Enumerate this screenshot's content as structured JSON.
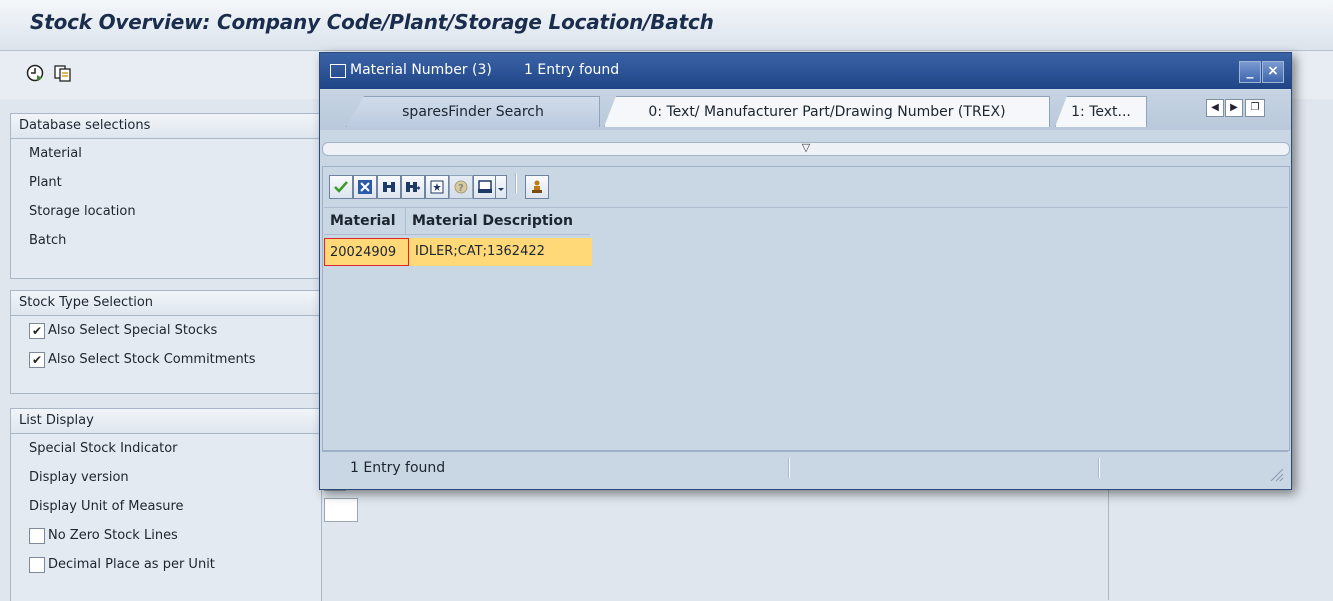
{
  "window": {
    "title": "Stock Overview: Company Code/Plant/Storage Location/Batch"
  },
  "toolbar": {
    "execute_icon": "clock-execute-icon",
    "copy_icon": "copy-selection-icon"
  },
  "groups": {
    "database": {
      "title": "Database selections",
      "fields": [
        "Material",
        "Plant",
        "Storage location",
        "Batch"
      ]
    },
    "stock_type": {
      "title": "Stock Type Selection",
      "checkboxes": [
        {
          "label": "Also Select Special Stocks",
          "checked": "✔"
        },
        {
          "label": "Also Select Stock Commitments",
          "checked": "✔"
        }
      ]
    },
    "list_display": {
      "title": "List Display",
      "fields": [
        "Special Stock Indicator",
        "Display version",
        "Display Unit of Measure"
      ],
      "checkboxes": [
        {
          "label": "No Zero Stock Lines",
          "checked": ""
        },
        {
          "label": "Decimal Place as per Unit",
          "checked": ""
        }
      ]
    }
  },
  "dialog": {
    "title": "Material Number (3)",
    "subtitle": "1 Entry found",
    "tabs": [
      {
        "label": "sparesFinder Search",
        "active": true
      },
      {
        "label": "0: Text/ Manufacturer Part/Drawing Number (TREX)",
        "active": false
      },
      {
        "label": "1: Text...",
        "active": false
      }
    ],
    "collapse_symbol": "▽",
    "columns": [
      "Material",
      "Material Description"
    ],
    "rows": [
      {
        "material": "20024909",
        "description": "IDLER;CAT;1362422"
      }
    ],
    "status": "1 Entry found"
  }
}
